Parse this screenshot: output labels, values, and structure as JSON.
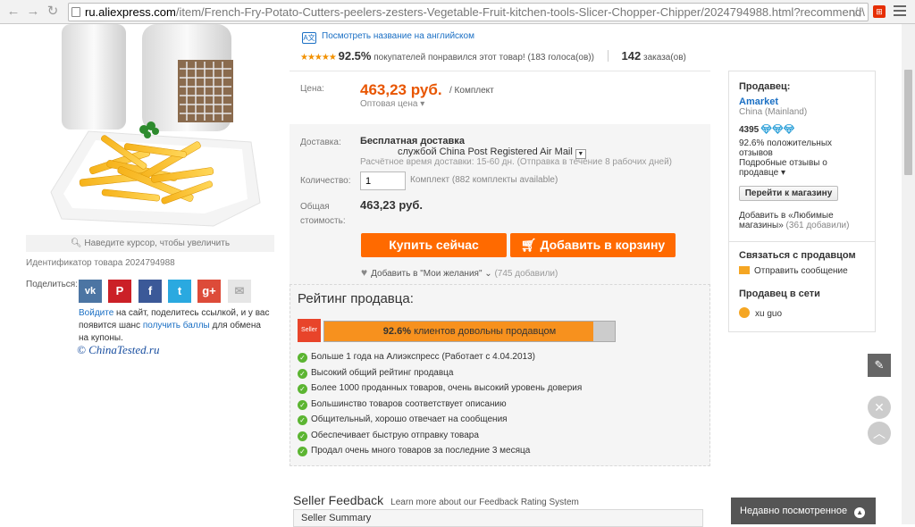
{
  "browser": {
    "url_host": "ru.aliexpress.com",
    "url_path": "/item/French-Fry-Potato-Cutters-peelers-zesters-Vegetable-Fruit-kitchen-tools-Slicer-Chopper-Chipper/2024794988.html?recommend\\"
  },
  "gallery": {
    "zoom_hint": "Наведите курсор, чтобы увеличить",
    "product_id": "Идентификатор товара 2024794988",
    "share_label": "Поделиться:",
    "share_buttons": [
      "vk",
      "P",
      "f",
      "t",
      "g+",
      "✉"
    ],
    "share_login": "Войдите",
    "share_text_1": " на сайт, поделитесь ссылкой, и у вас появится шанс ",
    "share_points": "получить баллы",
    "share_text_2": " для обмена на купоны.",
    "watermark": "© ChinaTested.ru"
  },
  "product": {
    "translate_link": "Посмотреть название на английском",
    "rating_percent": "92.5%",
    "rating_text": "покупателей понравился этот товар! (183 голоса(ов))",
    "stars_value": 4.5,
    "orders_count": "142",
    "orders_label": "заказа(ов)",
    "price_label": "Цена:",
    "price": "463,23 руб.",
    "price_unit": "/ Комплект",
    "wholesale": "Оптовая цена ▾",
    "shipping_label": "Доставка:",
    "shipping_title": "Бесплатная доставка",
    "shipping_service": "службой China Post Registered Air Mail",
    "shipping_note": "Расчётное время доставки: 15-60 дн. (Отправка в течение 8 рабочих дней)",
    "quantity_label": "Количество:",
    "quantity_value": "1",
    "quantity_note": "Комплект (882 комплекты available)",
    "total_label": "Общая стоимость:",
    "total_price": "463,23 руб.",
    "buy_now": "Купить сейчас",
    "add_to_cart": "Добавить в корзину",
    "wishlist": "Добавить в \"Мои желания\" ⌄",
    "wishlist_count": "(745 добавили)"
  },
  "seller_rating": {
    "title": "Рейтинг продавца:",
    "badge": "Seller Brand",
    "bar_percent_value": 92.6,
    "bar_percent": "92.6%",
    "bar_text": "клиентов довольны продавцом",
    "items": [
      "Больше 1 года на Алиэкспресс (Работает с 4.04.2013)",
      "Высокий общий рейтинг продавца",
      "Более 1000 проданных товаров, очень высокий уровень доверия",
      "Большинство товаров соответствует описанию",
      "Общительный, хорошо отвечает на сообщения",
      "Обеспечивает быструю отправку товара",
      "Продал очень много товаров за последние 3 месяца"
    ]
  },
  "feedback": {
    "title": "Seller Feedback",
    "link": "Learn more about our Feedback Rating System",
    "summary": "Seller Summary"
  },
  "seller": {
    "title": "Продавец:",
    "name": "Amarket",
    "country": "China (Mainland)",
    "score": "4395",
    "positive": "92.6% положительных отзывов",
    "detail": "Подробные отзывы о продавце ▾",
    "store_button": "Перейти к магазину",
    "favorites": "Добавить в «Любимые магазины»",
    "favorites_count": "(361 добавили)",
    "contact_title": "Связаться с продавцом",
    "send_message": "Отправить сообщение",
    "online_title": "Продавец в сети",
    "online_user": "xu guo"
  },
  "recent": {
    "label": "Недавно посмотренное"
  },
  "colors": {
    "accent": "#ff6a00",
    "price": "#e85500",
    "link": "#1a6fc4",
    "success": "#5cb532"
  }
}
